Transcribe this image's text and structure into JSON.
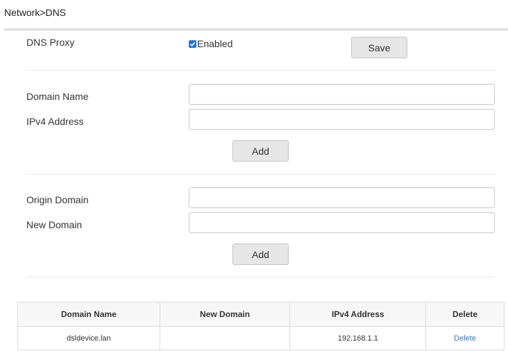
{
  "breadcrumb": "Network>DNS",
  "dns_proxy": {
    "label": "DNS Proxy",
    "checkbox_checked": true,
    "checkbox_label": "Enabled",
    "save_label": "Save"
  },
  "host_form": {
    "domain_name_label": "Domain Name",
    "domain_name_value": "",
    "ipv4_label": "IPv4 Address",
    "ipv4_value": "",
    "add_label": "Add"
  },
  "rewrite_form": {
    "origin_label": "Origin Domain",
    "origin_value": "",
    "new_label": "New Domain",
    "new_value": "",
    "add_label": "Add"
  },
  "table": {
    "headers": [
      "Domain Name",
      "New Domain",
      "IPv4 Address",
      "Delete"
    ],
    "rows": [
      {
        "domain": "dsldevice.lan",
        "new_domain": "",
        "ipv4": "192.168.1.1",
        "delete": "Delete"
      }
    ]
  },
  "colors": {
    "accent": "#1a73e8",
    "link": "#3a74b8",
    "button_bg": "#e6e6e6"
  }
}
